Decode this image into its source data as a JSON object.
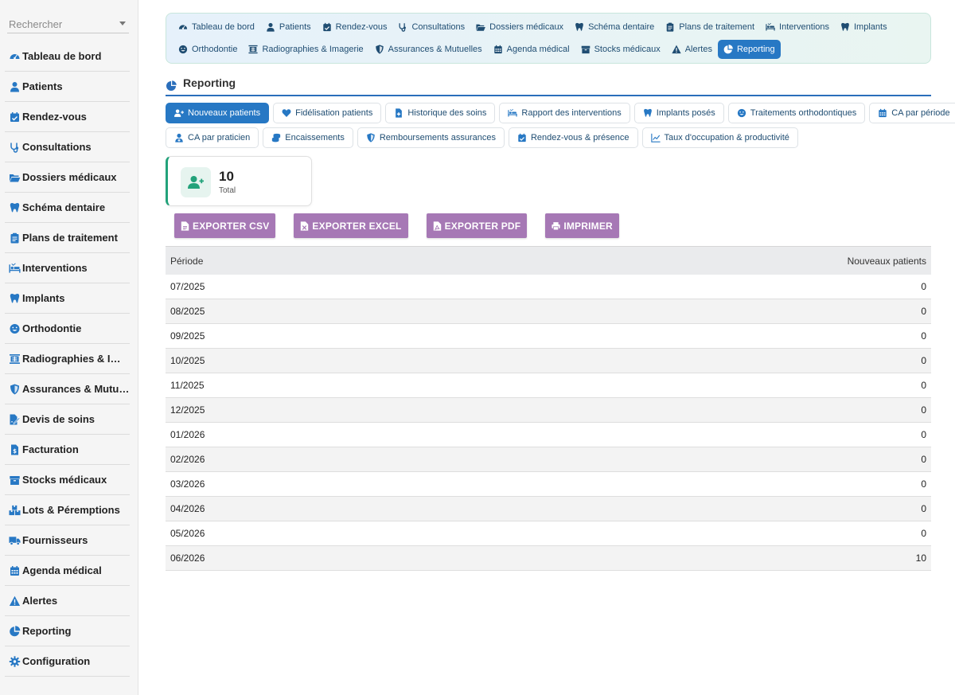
{
  "colors": {
    "accent": "#2778c4",
    "export": "#a678b5",
    "success": "#22a27a"
  },
  "sidebar": {
    "search_placeholder": "Rechercher",
    "items": [
      {
        "label": "Tableau de bord",
        "icon": "gauge-icon"
      },
      {
        "label": "Patients",
        "icon": "user-icon"
      },
      {
        "label": "Rendez-vous",
        "icon": "calendar-check-icon"
      },
      {
        "label": "Consultations",
        "icon": "stethoscope-icon"
      },
      {
        "label": "Dossiers médicaux",
        "icon": "folder-open-icon"
      },
      {
        "label": "Schéma dentaire",
        "icon": "tooth-icon"
      },
      {
        "label": "Plans de traitement",
        "icon": "clipboard-icon"
      },
      {
        "label": "Interventions",
        "icon": "procedure-bed-icon"
      },
      {
        "label": "Implants",
        "icon": "tooth-icon"
      },
      {
        "label": "Orthodontie",
        "icon": "smile-icon"
      },
      {
        "label": "Radiographies & Imagerie",
        "icon": "xray-icon"
      },
      {
        "label": "Assurances & Mutuelles",
        "icon": "shield-icon"
      },
      {
        "label": "Devis de soins",
        "icon": "file-signature-icon"
      },
      {
        "label": "Facturation",
        "icon": "invoice-icon"
      },
      {
        "label": "Stocks médicaux",
        "icon": "box-icon"
      },
      {
        "label": "Lots & Péremptions",
        "icon": "boxes-icon"
      },
      {
        "label": "Fournisseurs",
        "icon": "truck-icon"
      },
      {
        "label": "Agenda médical",
        "icon": "calendar-icon"
      },
      {
        "label": "Alertes",
        "icon": "warning-icon"
      },
      {
        "label": "Reporting",
        "icon": "pie-chart-icon"
      },
      {
        "label": "Configuration",
        "icon": "gear-icon"
      }
    ]
  },
  "topnav": {
    "row1": [
      {
        "label": "Tableau de bord",
        "icon": "gauge-icon"
      },
      {
        "label": "Patients",
        "icon": "user-icon"
      },
      {
        "label": "Rendez-vous",
        "icon": "calendar-check-icon"
      },
      {
        "label": "Consultations",
        "icon": "stethoscope-icon"
      },
      {
        "label": "Dossiers médicaux",
        "icon": "folder-open-icon"
      },
      {
        "label": "Schéma dentaire",
        "icon": "tooth-icon"
      },
      {
        "label": "Plans de traitement",
        "icon": "clipboard-icon"
      },
      {
        "label": "Interventions",
        "icon": "procedure-bed-icon"
      },
      {
        "label": "Implants",
        "icon": "tooth-icon"
      }
    ],
    "row2": [
      {
        "label": "Orthodontie",
        "icon": "smile-icon"
      },
      {
        "label": "Radiographies & Imagerie",
        "icon": "xray-icon"
      },
      {
        "label": "Assurances & Mutuelles",
        "icon": "shield-icon"
      },
      {
        "label": "Agenda médical",
        "icon": "calendar-icon"
      },
      {
        "label": "Stocks médicaux",
        "icon": "box-icon"
      },
      {
        "label": "Alertes",
        "icon": "warning-icon"
      },
      {
        "label": "Reporting",
        "icon": "pie-chart-icon",
        "active": true
      }
    ]
  },
  "section": {
    "title": "Reporting"
  },
  "report_tabs": {
    "row1": [
      {
        "label": "Nouveaux patients",
        "icon": "user-plus-icon",
        "active": true
      },
      {
        "label": "Fidélisation patients",
        "icon": "heart-icon"
      },
      {
        "label": "Historique des soins",
        "icon": "file-medical-icon"
      },
      {
        "label": "Rapport des interventions",
        "icon": "procedure-bed-icon"
      },
      {
        "label": "Implants posés",
        "icon": "tooth-icon"
      },
      {
        "label": "Traitements orthodontiques",
        "icon": "smile-icon"
      },
      {
        "label": "CA par période",
        "icon": "calendar-icon"
      }
    ],
    "row2": [
      {
        "label": "CA par praticien",
        "icon": "user-doctor-icon"
      },
      {
        "label": "Encaissements",
        "icon": "coins-icon"
      },
      {
        "label": "Remboursements assurances",
        "icon": "shield-icon"
      },
      {
        "label": "Rendez-vous & présence",
        "icon": "calendar-check-icon"
      },
      {
        "label": "Taux d'occupation & productivité",
        "icon": "line-chart-icon"
      }
    ]
  },
  "stat": {
    "value": "10",
    "label": "Total"
  },
  "exports": [
    {
      "label": "EXPORTER CSV",
      "icon": "file-csv-icon"
    },
    {
      "label": "EXPORTER EXCEL",
      "icon": "file-excel-icon"
    },
    {
      "label": "EXPORTER PDF",
      "icon": "file-pdf-icon"
    },
    {
      "label": "IMPRIMER",
      "icon": "printer-icon"
    }
  ],
  "table": {
    "headers": [
      "Période",
      "Nouveaux patients"
    ],
    "rows": [
      [
        "07/2025",
        "0"
      ],
      [
        "08/2025",
        "0"
      ],
      [
        "09/2025",
        "0"
      ],
      [
        "10/2025",
        "0"
      ],
      [
        "11/2025",
        "0"
      ],
      [
        "12/2025",
        "0"
      ],
      [
        "01/2026",
        "0"
      ],
      [
        "02/2026",
        "0"
      ],
      [
        "03/2026",
        "0"
      ],
      [
        "04/2026",
        "0"
      ],
      [
        "05/2026",
        "0"
      ],
      [
        "06/2026",
        "10"
      ]
    ]
  }
}
